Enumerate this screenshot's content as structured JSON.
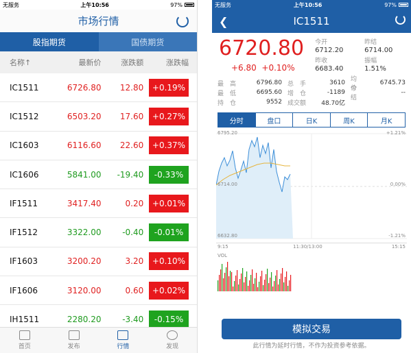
{
  "left": {
    "status": {
      "carrier": "无服务",
      "time": "上午10:56",
      "battery": "97%"
    },
    "title": "市场行情",
    "segments": [
      "股指期货",
      "国债期货"
    ],
    "columns": [
      "名称↑",
      "最新价",
      "涨跌额",
      "涨跌幅"
    ],
    "rows": [
      {
        "name": "IC1511",
        "price": "6726.80",
        "chg": "12.80",
        "pct": "+0.19%",
        "dir": "up"
      },
      {
        "name": "IC1512",
        "price": "6503.20",
        "chg": "17.60",
        "pct": "+0.27%",
        "dir": "up"
      },
      {
        "name": "IC1603",
        "price": "6116.60",
        "chg": "22.60",
        "pct": "+0.37%",
        "dir": "up"
      },
      {
        "name": "IC1606",
        "price": "5841.00",
        "chg": "-19.40",
        "pct": "-0.33%",
        "dir": "dn"
      },
      {
        "name": "IF1511",
        "price": "3417.40",
        "chg": "0.20",
        "pct": "+0.01%",
        "dir": "up"
      },
      {
        "name": "IF1512",
        "price": "3322.00",
        "chg": "-0.40",
        "pct": "-0.01%",
        "dir": "dn"
      },
      {
        "name": "IF1603",
        "price": "3200.20",
        "chg": "3.20",
        "pct": "+0.10%",
        "dir": "up"
      },
      {
        "name": "IF1606",
        "price": "3120.00",
        "chg": "0.60",
        "pct": "+0.02%",
        "dir": "up"
      },
      {
        "name": "IH1511",
        "price": "2280.20",
        "chg": "-3.40",
        "pct": "-0.15%",
        "dir": "dn"
      }
    ],
    "tabs": [
      "首页",
      "发布",
      "行情",
      "发现"
    ]
  },
  "right": {
    "status": {
      "carrier": "无服务",
      "time": "上午10:56",
      "battery": "97%"
    },
    "title": "IC1511",
    "price": "6720.80",
    "change": "+6.80",
    "change_pct": "+0.10%",
    "quote": [
      {
        "label": "今开",
        "value": "6712.20"
      },
      {
        "label": "昨结",
        "value": "6714.00"
      },
      {
        "label": "昨收",
        "value": "6683.40"
      },
      {
        "label": "振幅",
        "value": "1.51%"
      }
    ],
    "stats": [
      {
        "k1": "最　高",
        "v1": "6796.80",
        "k2": "总　手",
        "v2": "3610",
        "k3": "均　价",
        "v3": "6745.73"
      },
      {
        "k1": "最　低",
        "v1": "6695.60",
        "k2": "增　仓",
        "v2": "-1189",
        "k3": "今　结",
        "v3": "--"
      },
      {
        "k1": "持　仓",
        "v1": "9552",
        "k2": "成交额",
        "v2": "48.70亿",
        "k3": "",
        "v3": ""
      }
    ],
    "chart_tabs": [
      "分时",
      "盘口",
      "日K",
      "周K",
      "月K"
    ],
    "chart_labels": {
      "y_top": "6795.20",
      "y_mid": "6714.00",
      "y_bot": "6632.80",
      "pct_top": "+1.21%",
      "pct_mid": "0.00%",
      "pct_bot": "-1.21%",
      "t_start": "9:15",
      "t_mid": "11:30/13:00",
      "t_end": "15:15",
      "vol": "VOL"
    },
    "trade_button": "模拟交易",
    "disclaimer": "此行情为延时行情，不作为投资参考依据。"
  },
  "colors": {
    "brand": "#1f5fa6",
    "up": "#e8181c",
    "down": "#1fa31f"
  }
}
